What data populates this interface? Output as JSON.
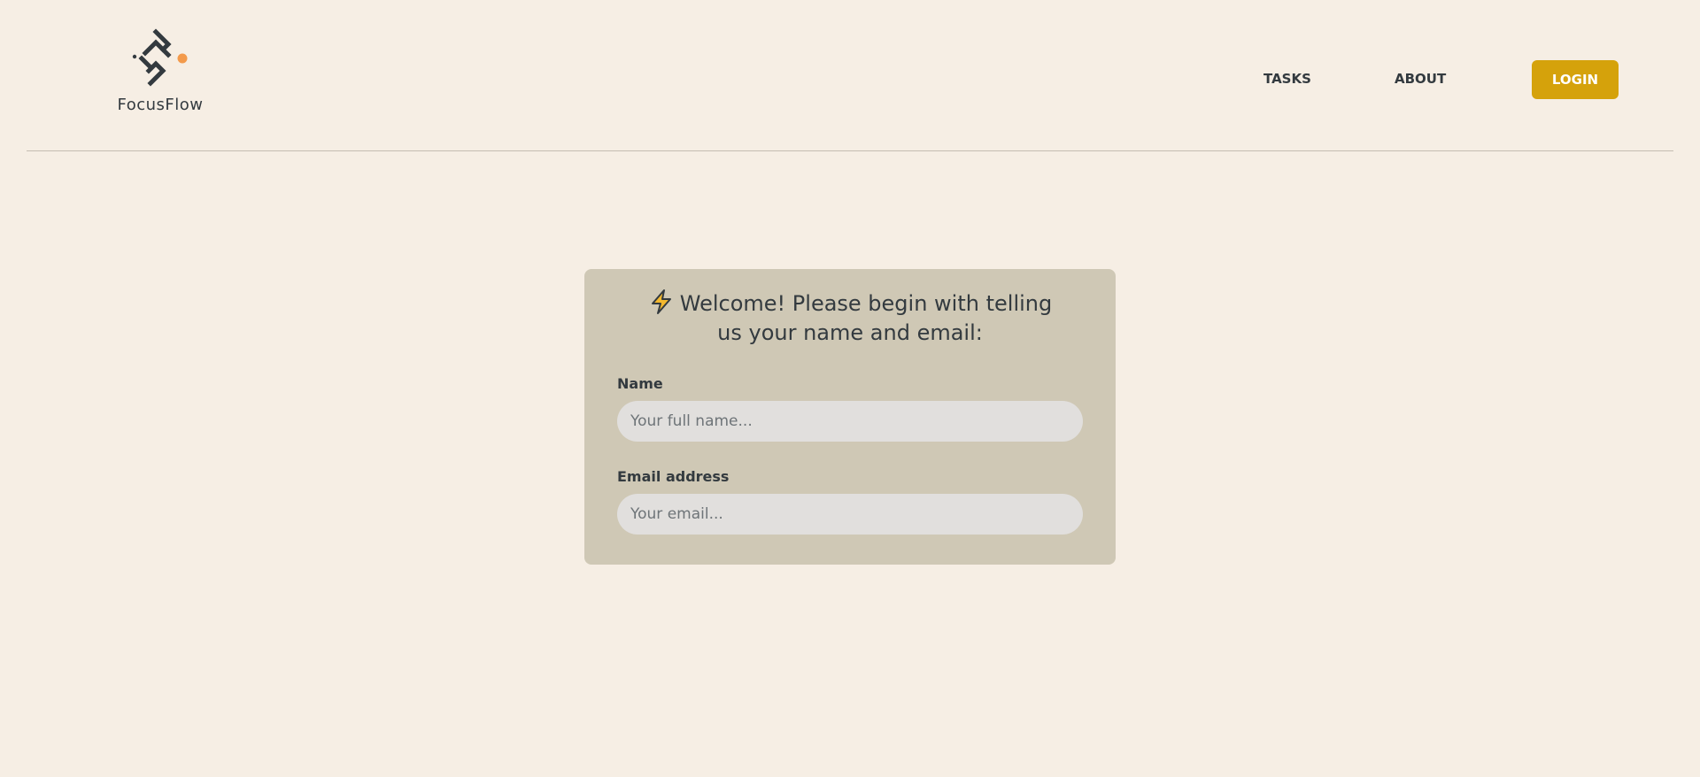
{
  "brand": {
    "name": "FocusFlow",
    "logo_icon": "focusflow-logo-icon",
    "accent_color": "#f39a4b"
  },
  "nav": {
    "tasks_label": "TASKS",
    "about_label": "ABOUT",
    "login_label": "LOGIN",
    "login_color": "#d5a20b"
  },
  "welcome_card": {
    "icon": "lightning-bolt-icon",
    "title": "Welcome! Please begin with telling us your name and email:",
    "name_label": "Name",
    "name_placeholder": "Your full name...",
    "name_value": "",
    "email_label": "Email address",
    "email_placeholder": "Your email...",
    "email_value": ""
  },
  "colors": {
    "background": "#f6eee4",
    "card": "#cfc8b5",
    "input": "#e1dfdd",
    "text": "#333a3f"
  }
}
